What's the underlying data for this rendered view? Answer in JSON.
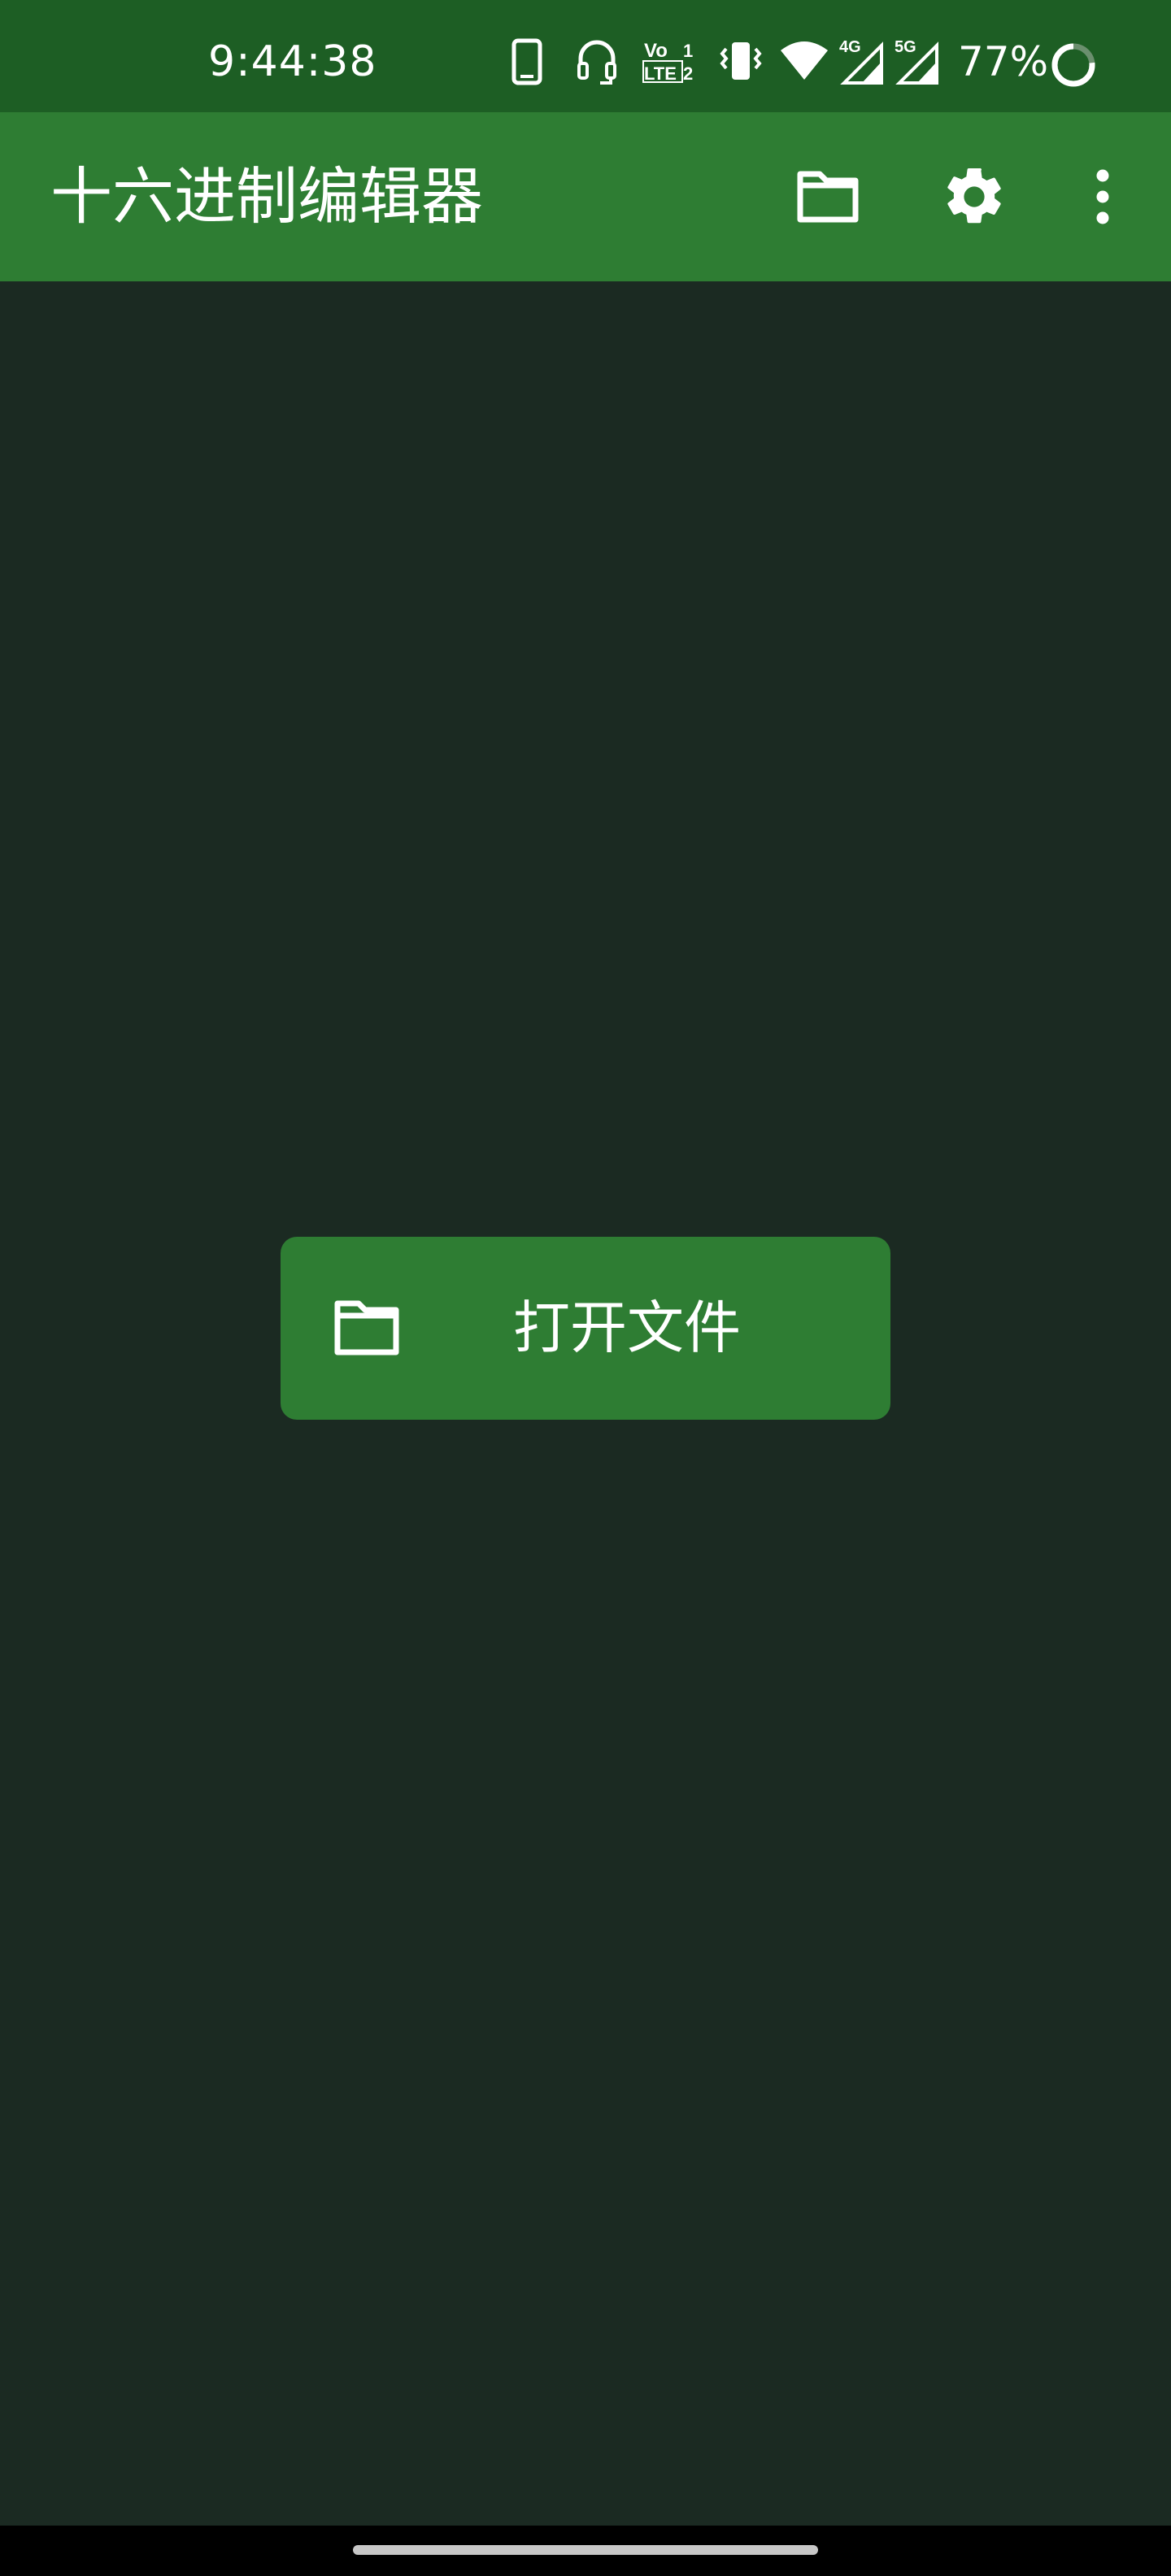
{
  "status_bar": {
    "time": "9:44:38",
    "battery_percent": "77%",
    "network_4g": "4G",
    "network_5g": "5G",
    "volte_top": "Vo",
    "volte_bottom": "LTE",
    "volte_sim_top": "1",
    "volte_sim_bottom": "2",
    "icons": [
      "phone-icon",
      "headset-icon",
      "volte-icon",
      "vibrate-icon",
      "wifi-icon",
      "signal-4g-icon",
      "signal-5g-icon",
      "battery-ring-icon"
    ]
  },
  "app_bar": {
    "title": "十六进制编辑器",
    "actions": [
      "folder-icon",
      "settings-gear-icon",
      "overflow-menu-icon"
    ]
  },
  "main": {
    "open_file_label": "打开文件",
    "open_file_icon": "folder-icon"
  },
  "colors": {
    "status_bar_bg": "#1d5e24",
    "app_bar_bg": "#2e7d33",
    "content_bg": "#1b2a22",
    "accent": "#2e7d33",
    "nav_bar_bg": "#000000"
  }
}
